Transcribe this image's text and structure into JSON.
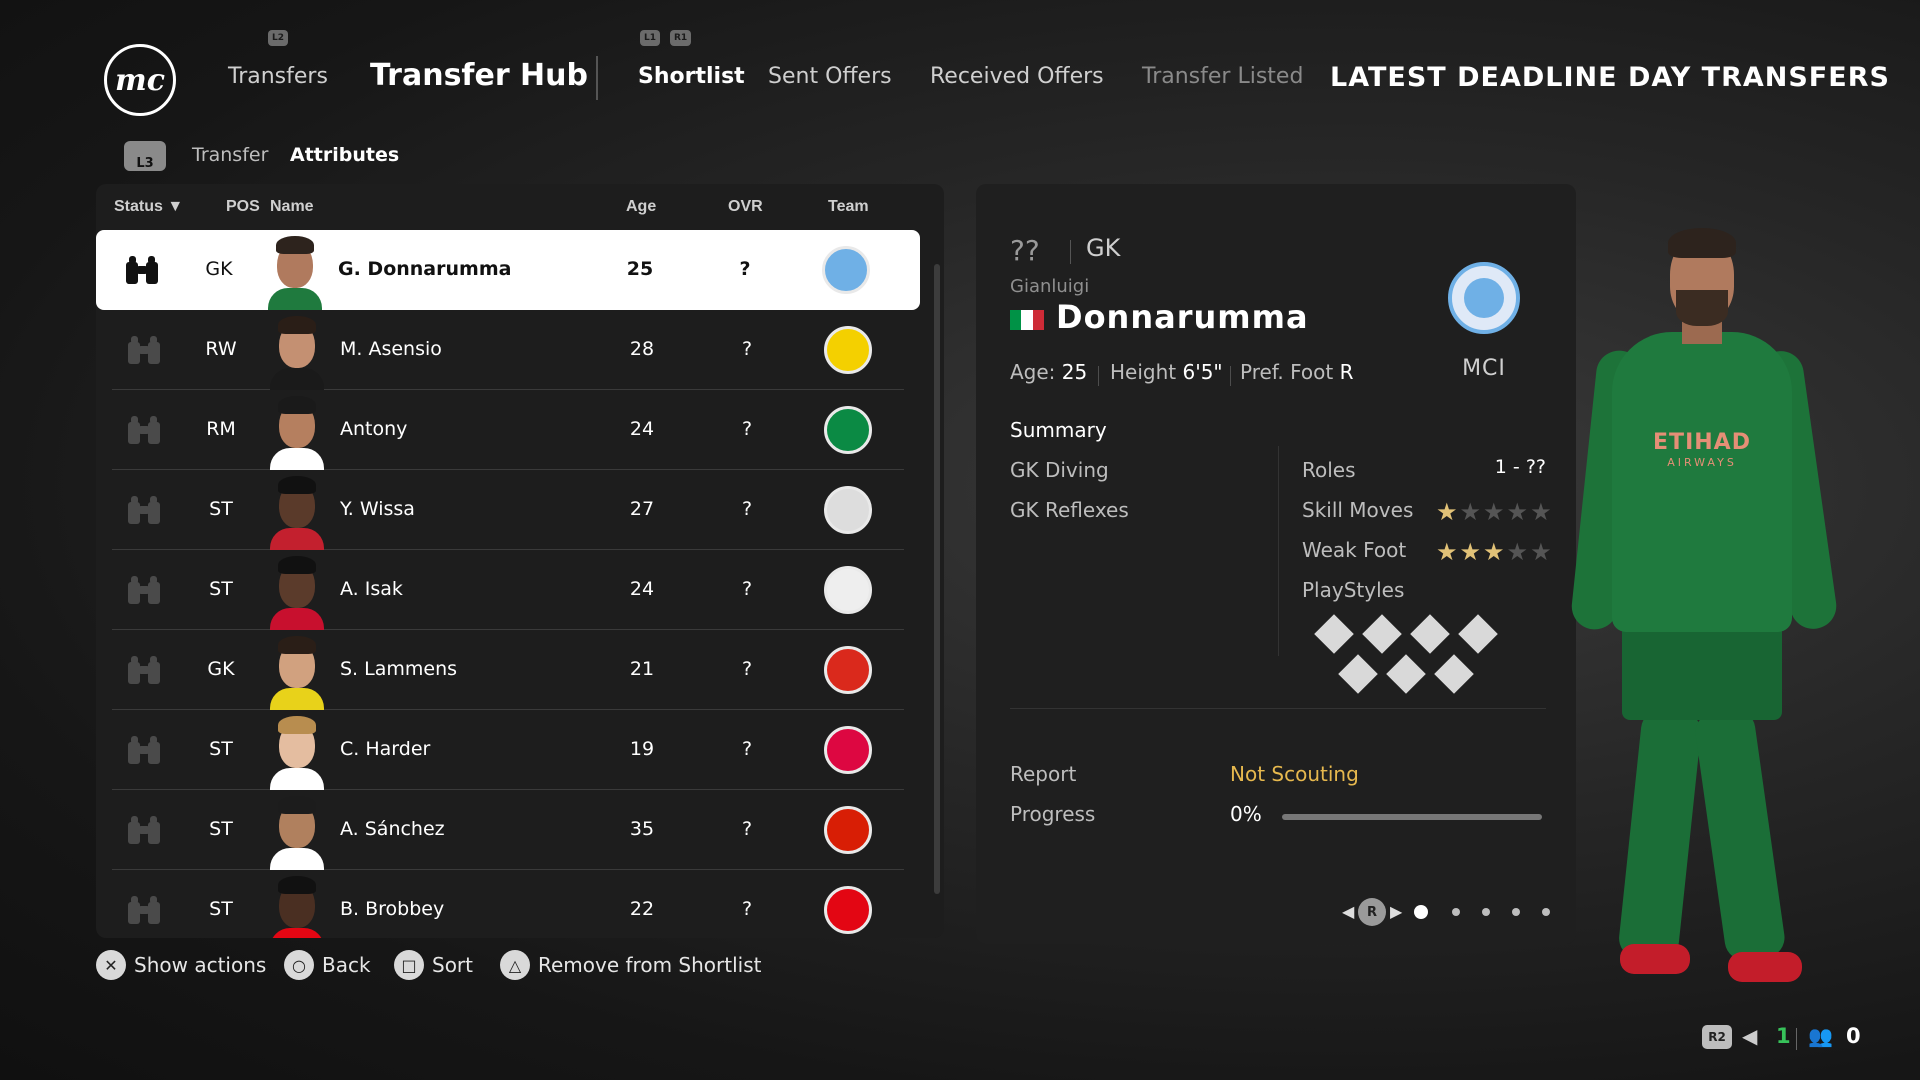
{
  "nav": {
    "logo": "mc",
    "transfers_label": "Transfers",
    "hub_title": "Transfer Hub",
    "tabs": [
      {
        "label": "Shortlist",
        "active": true
      },
      {
        "label": "Sent Offers",
        "active": false
      },
      {
        "label": "Received Offers",
        "active": false
      },
      {
        "label": "Transfer Listed",
        "active": false
      }
    ],
    "banner": "LATEST DEADLINE DAY TRANSFERS",
    "hints": {
      "l2": "L2",
      "l1": "L1",
      "r1": "R1"
    }
  },
  "breadcrumb": {
    "button": "L3",
    "items": [
      "Transfer",
      "Attributes"
    ]
  },
  "list": {
    "columns": {
      "status": "Status ▼",
      "pos": "POS",
      "name": "Name",
      "age": "Age",
      "ovr": "OVR",
      "team": "Team"
    },
    "rows": [
      {
        "pos": "GK",
        "name": "G. Donnarumma",
        "age": "25",
        "ovr": "?",
        "team_icon": "man-city-crest",
        "crest_color": "#6fb0e6",
        "skin": "#b07a5e",
        "hair": "#2d231d",
        "kit": "#1f7a3e",
        "selected": true
      },
      {
        "pos": "RW",
        "name": "M. Asensio",
        "age": "28",
        "ovr": "?",
        "team_icon": "fenerbahce-crest",
        "crest_color": "#f4d000",
        "skin": "#c49072",
        "hair": "#2a1e17",
        "kit": "#1a1a1a",
        "selected": false
      },
      {
        "pos": "RM",
        "name": "Antony",
        "age": "24",
        "ovr": "?",
        "team_icon": "real-betis-crest",
        "crest_color": "#0b8a44",
        "skin": "#b57f5f",
        "hair": "#1a1a1a",
        "kit": "#ffffff",
        "selected": false
      },
      {
        "pos": "ST",
        "name": "Y. Wissa",
        "age": "27",
        "ovr": "?",
        "team_icon": "newcastle-crest",
        "crest_color": "#dddddd",
        "skin": "#5a3a2a",
        "hair": "#111111",
        "kit": "#c3202e",
        "selected": false
      },
      {
        "pos": "ST",
        "name": "A. Isak",
        "age": "24",
        "ovr": "?",
        "team_icon": "liverpool-crest",
        "crest_color": "#eeeeee",
        "skin": "#5b3b2b",
        "hair": "#111111",
        "kit": "#c8102e",
        "selected": false
      },
      {
        "pos": "GK",
        "name": "S. Lammens",
        "age": "21",
        "ovr": "?",
        "team_icon": "man-united-crest",
        "crest_color": "#da291c",
        "skin": "#d1a17f",
        "hair": "#2a1e17",
        "kit": "#e8d21a",
        "selected": false
      },
      {
        "pos": "ST",
        "name": "C. Harder",
        "age": "19",
        "ovr": "?",
        "team_icon": "rb-leipzig-crest",
        "crest_color": "#dd0741",
        "skin": "#e4bda0",
        "hair": "#b88d4f",
        "kit": "#ffffff",
        "selected": false
      },
      {
        "pos": "ST",
        "name": "A. Sánchez",
        "age": "35",
        "ovr": "?",
        "team_icon": "sevilla-crest",
        "crest_color": "#d81e05",
        "skin": "#b0805e",
        "hair": "#1c1c1c",
        "kit": "#ffffff",
        "selected": false
      },
      {
        "pos": "ST",
        "name": "B. Brobbey",
        "age": "22",
        "ovr": "?",
        "team_icon": "sunderland-crest",
        "crest_color": "#e30613",
        "skin": "#4a2f22",
        "hair": "#111111",
        "kit": "#e30613",
        "selected": false
      }
    ]
  },
  "prompts": [
    {
      "button": "✕",
      "label": "Show actions"
    },
    {
      "button": "○",
      "label": "Back"
    },
    {
      "button": "□",
      "label": "Sort"
    },
    {
      "button": "△",
      "label": "Remove from Shortlist"
    }
  ],
  "detail": {
    "ovr": "??",
    "position": "GK",
    "first_name": "Gianluigi",
    "last_name": "Donnarumma",
    "flag_colors": [
      "#009246",
      "#ffffff",
      "#ce2b37"
    ],
    "club_abbr": "MCI",
    "age_label": "Age:",
    "age": "25",
    "height_label": "Height",
    "height": "6'5\"",
    "foot_label": "Pref. Foot",
    "foot": "R",
    "summary_title": "Summary",
    "attributes": [
      "GK Diving",
      "GK Reflexes"
    ],
    "roles_label": "Roles",
    "roles_value": "1 - ??",
    "skill_moves_label": "Skill Moves",
    "skill_moves": 1,
    "weak_foot_label": "Weak Foot",
    "weak_foot": 3,
    "playstyles_label": "PlayStyles",
    "report_label": "Report",
    "report_value": "Not Scouting",
    "progress_label": "Progress",
    "progress_value": "0%",
    "progress_fraction": 0,
    "pager": {
      "button": "R",
      "pages": 5,
      "active": 0
    }
  },
  "player_figure": {
    "sponsor": "ETIHAD",
    "sponsor_sub": "AIRWAYS"
  },
  "status_tray": {
    "r2": "R2",
    "active_count": "1",
    "people_count": "0"
  }
}
